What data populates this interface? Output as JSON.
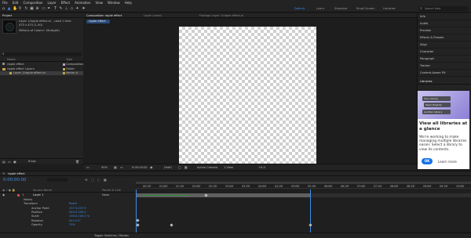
{
  "menu": [
    "File",
    "Edit",
    "Composition",
    "Layer",
    "Effect",
    "Animation",
    "View",
    "Window",
    "Help"
  ],
  "workspaces": [
    "Default",
    "Learn",
    "Standard",
    "Small Screen",
    "Libraries"
  ],
  "search_placeholder": "Search Help",
  "project": {
    "tab": "Project",
    "item_name": "Layer 1/ripple effect.ai",
    "item_used": ", used 1 time",
    "item_size": "475 x 475 (1.00)",
    "item_type": "Millions of Colors+ (Straight)",
    "columns": {
      "name": "Name",
      "type": "Type"
    },
    "rows": [
      {
        "name": "ripple effect",
        "type": "Composition"
      },
      {
        "name": "ripple effect Layers",
        "type": "Folder"
      },
      {
        "name": "Layer 1/ripple effect.ai",
        "type": "Vector A"
      }
    ],
    "bpc": "8 bpc"
  },
  "viewer": {
    "comp_tab": "Composition ripple effect",
    "layer_tab": "Layer (none)",
    "footage_tab": "Footage Layer 1/ripple effect.ai",
    "subtab": "ripple effect"
  },
  "viewer_bar": {
    "zoom": "50%",
    "timecode": "0:00:00:00",
    "resolution": "(Half)",
    "camera": "Active Camera",
    "views": "1 View",
    "offset": "+0.0"
  },
  "right_panel": [
    "Info",
    "Audio",
    "Preview",
    "Effects & Presets",
    "Align",
    "Character",
    "Paragraph",
    "Tracker",
    "Content-Aware Fill"
  ],
  "libraries": {
    "tab": "Libraries",
    "heading": "View all libraries at a glance",
    "body": "We're working to make managing multiple libraries easier. Select a library to view its contents.",
    "ok": "OK",
    "learn_more": "Learn more",
    "cards": [
      "Your Library",
      "Team Projects",
      "Another Library"
    ]
  },
  "timeline": {
    "tab": "ripple effect",
    "timecode": "0:00:00:00",
    "col_source": "Source Name",
    "col_parent": "Parent & Link",
    "layer_num": "1",
    "layer_name": "Layer 1",
    "parent": "None",
    "props": [
      {
        "name": "Masks",
        "value": ""
      },
      {
        "name": "Transform",
        "value": "Reset"
      },
      {
        "name": "Anchor Point",
        "value": "237.5,237.5"
      },
      {
        "name": "Position",
        "value": "540.0,540.0"
      },
      {
        "name": "Scale",
        "value": "100.0,100.0 %"
      },
      {
        "name": "Rotation",
        "value": "0x+0.0°"
      },
      {
        "name": "Opacity",
        "value": "70%"
      }
    ],
    "ticks": [
      "00:15f",
      "01:00f",
      "01:15f",
      "02:00f",
      "02:15f",
      "03:00f",
      "03:15f",
      "04:00f",
      "04:15f",
      "05:00f",
      "05:15f",
      "06:00f",
      "06:15f",
      "07:00f",
      "07:15f",
      "08:00f",
      "08:15f",
      "09:00f",
      "09:15f",
      "10:00f"
    ]
  },
  "footer": {
    "toggle": "Toggle Switches / Modes"
  }
}
